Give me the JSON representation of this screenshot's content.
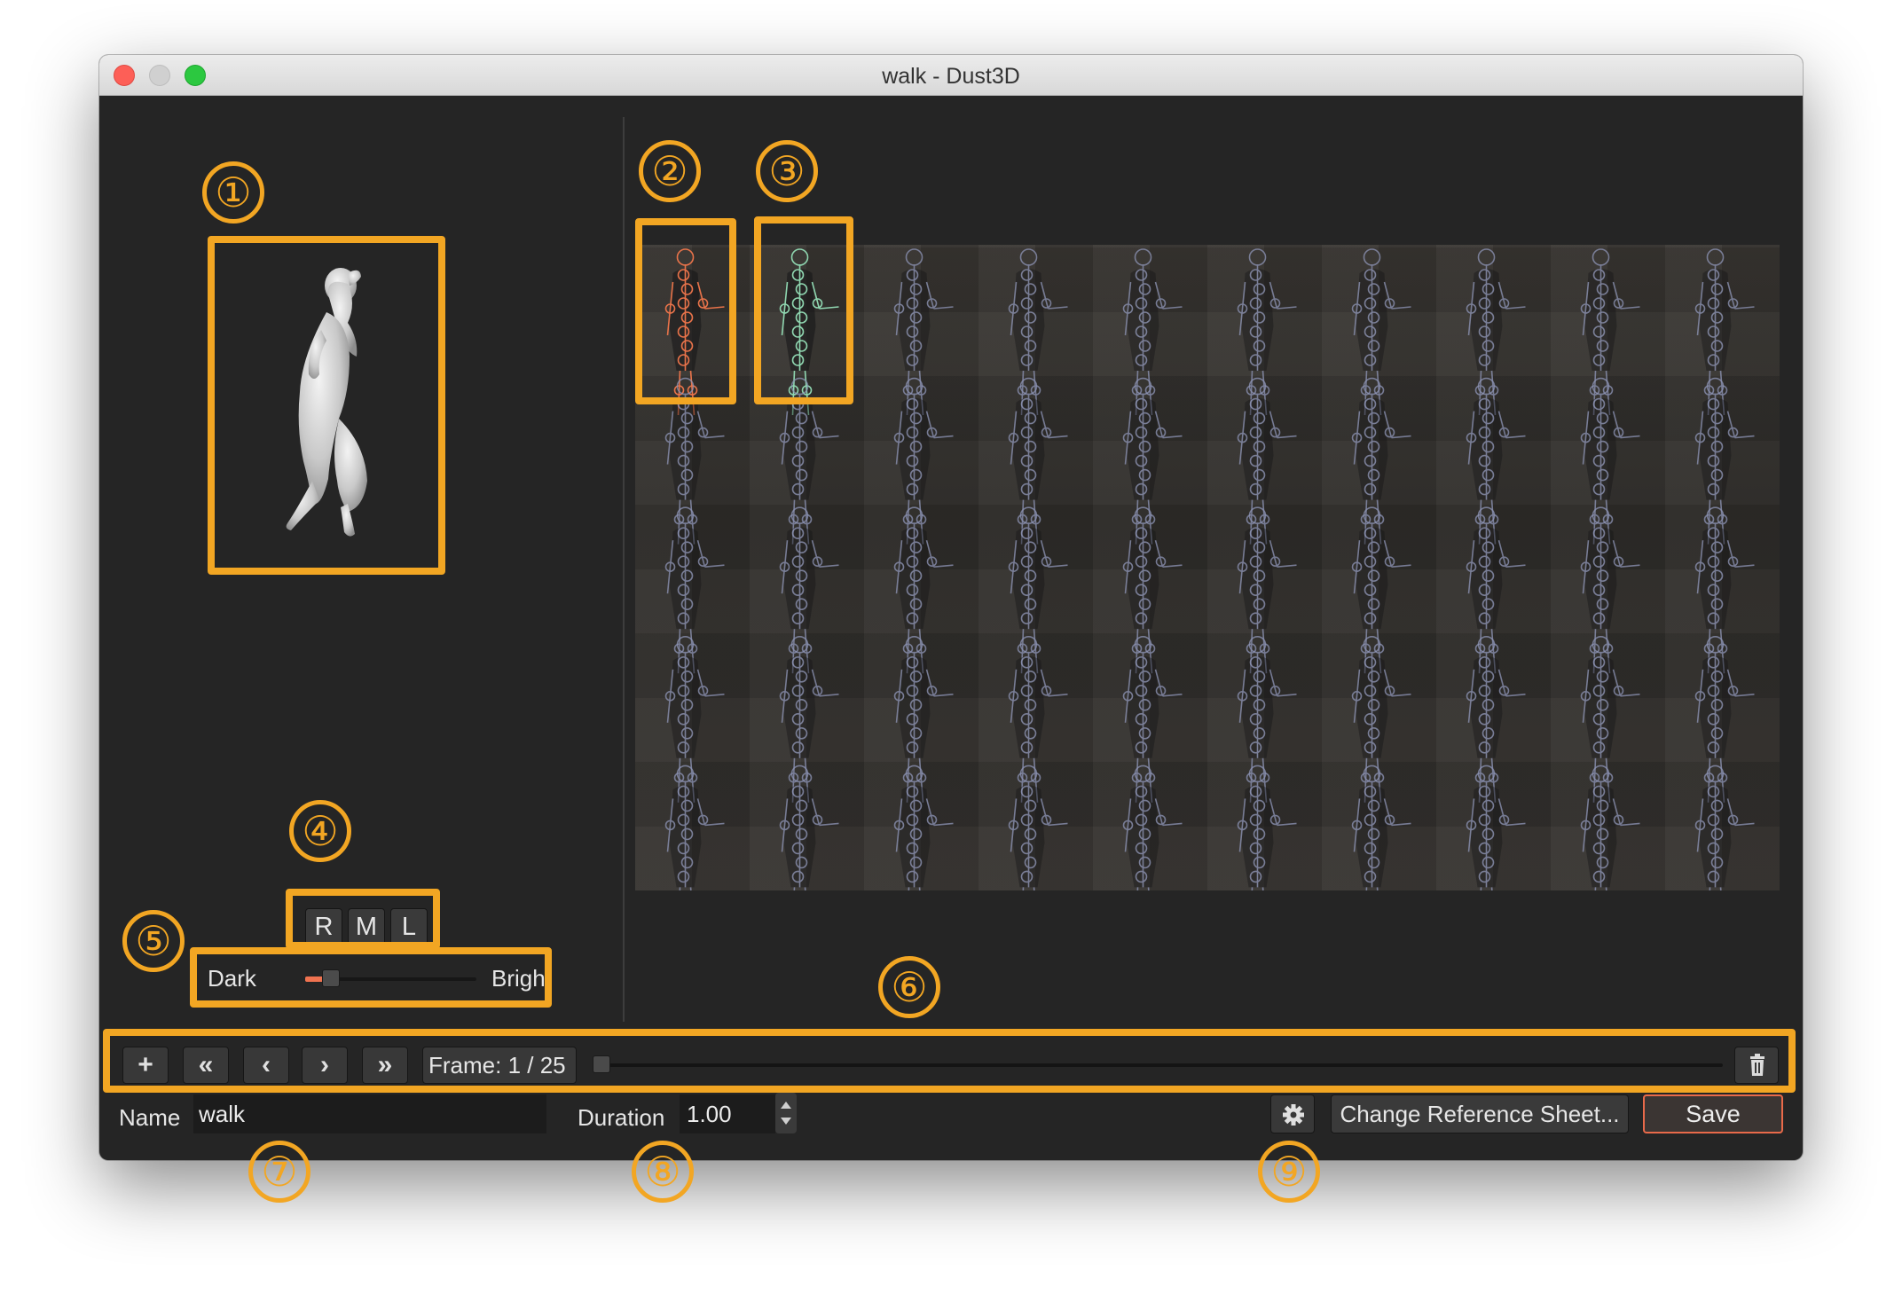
{
  "window": {
    "title": "walk - Dust3D"
  },
  "preview": {
    "icon": "pose-model-preview"
  },
  "sprite_sheet": {
    "columns": 10,
    "rows": 5,
    "highlight_colors": {
      "front": "#e8734a",
      "side": "#8fd6b0",
      "default": "#8f96b8"
    }
  },
  "pose_buttons": {
    "r": "R",
    "m": "M",
    "l": "L"
  },
  "brightness": {
    "dark_label": "Dark",
    "bright_label": "Bright",
    "value": 0.15
  },
  "toolbar": {
    "add_label": "+",
    "first_label": "«",
    "prev_label": "‹",
    "next_label": "›",
    "last_label": "»",
    "frame_label": "Frame:  1 / 25",
    "frame_progress": 0.0
  },
  "form": {
    "name_label": "Name",
    "name_value": "walk",
    "duration_label": "Duration",
    "duration_value": "1.00",
    "change_sheet_label": "Change Reference Sheet...",
    "save_label": "Save"
  },
  "annotations": [
    "①",
    "②",
    "③",
    "④",
    "⑤",
    "⑥",
    "⑦",
    "⑧",
    "⑨"
  ],
  "colors": {
    "accent": "#f2a623",
    "save_border": "#e86a4a",
    "background": "#252525"
  }
}
